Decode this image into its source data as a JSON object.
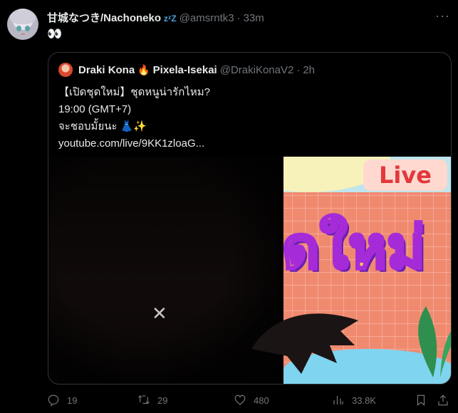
{
  "tweet": {
    "display_name": "甘城なつき/Nachoneko",
    "name_suffix": "zᶻZ",
    "handle": "@amsrntk3",
    "separator": "·",
    "time": "33m",
    "text": "👀",
    "more_label": "···"
  },
  "quoted": {
    "display_name": "Draki Kona",
    "emoji": "🔥",
    "display_name_2": "Pixela-Isekai",
    "handle": "@DrakiKonaV2",
    "separator": "·",
    "time": "2h",
    "lines": [
      "【เปิดชุดใหม่】ชุดหนูน่ารักไหม?",
      "19:00 (GMT+7)",
      "จะชอบมั้ยนะ 👗✨",
      "youtube.com/live/9KK1zloaG..."
    ],
    "thumbnail": {
      "live_label": "Live",
      "title_text": "ชุดใหม่"
    }
  },
  "actions": {
    "reply_count": "19",
    "retweet_count": "29",
    "like_count": "480",
    "views_count": "33.8K"
  },
  "icons": {
    "reply": "reply-icon",
    "retweet": "retweet-icon",
    "like": "heart-icon",
    "views": "views-icon",
    "bookmark": "bookmark-icon",
    "share": "share-icon"
  },
  "colors": {
    "background": "#000000",
    "text": "#e7e9ea",
    "muted": "#71767b",
    "border": "#2f3336",
    "accent_zzz": "#4aa3df"
  }
}
